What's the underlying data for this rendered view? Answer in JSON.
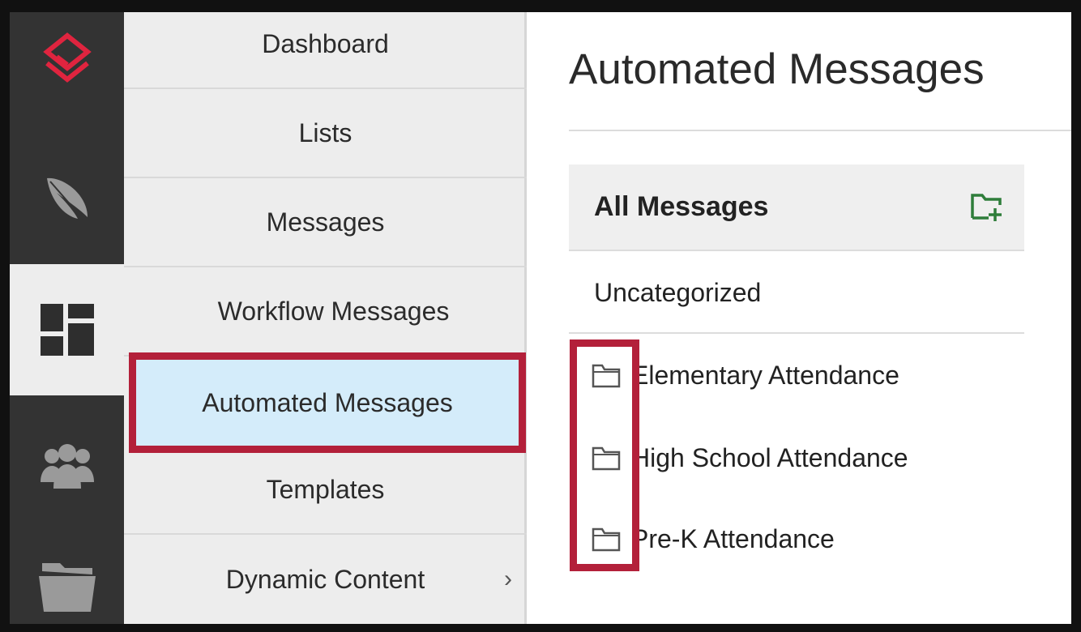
{
  "colors": {
    "rail_bg": "#333333",
    "nav_bg": "#ededed",
    "selected_bg": "#d4ecfa",
    "highlight": "#b3203a",
    "logo": "#e0243f",
    "new_folder_icon": "#2e7d3a"
  },
  "rail": {
    "items": [
      {
        "icon": "logo-icon"
      },
      {
        "icon": "feather-icon"
      },
      {
        "icon": "dashboard-grid-icon",
        "active": true
      },
      {
        "icon": "users-group-icon"
      },
      {
        "icon": "folder-icon"
      }
    ]
  },
  "nav": {
    "items": [
      {
        "label": "Dashboard"
      },
      {
        "label": "Lists"
      },
      {
        "label": "Messages"
      },
      {
        "label": "Workflow Messages"
      },
      {
        "label": "Automated Messages",
        "selected": true
      },
      {
        "label": "Templates"
      },
      {
        "label": "Dynamic Content",
        "has_submenu": true
      }
    ],
    "chevron": "›"
  },
  "main": {
    "title": "Automated Messages",
    "all_messages": {
      "label": "All Messages",
      "action_icon": "new-folder-icon"
    },
    "uncategorized": {
      "label": "Uncategorized"
    },
    "folders": [
      {
        "label": "Elementary Attendance",
        "icon": "folder-icon"
      },
      {
        "label": "High School Attendance",
        "icon": "folder-icon"
      },
      {
        "label": "Pre-K Attendance",
        "icon": "folder-icon"
      }
    ]
  }
}
